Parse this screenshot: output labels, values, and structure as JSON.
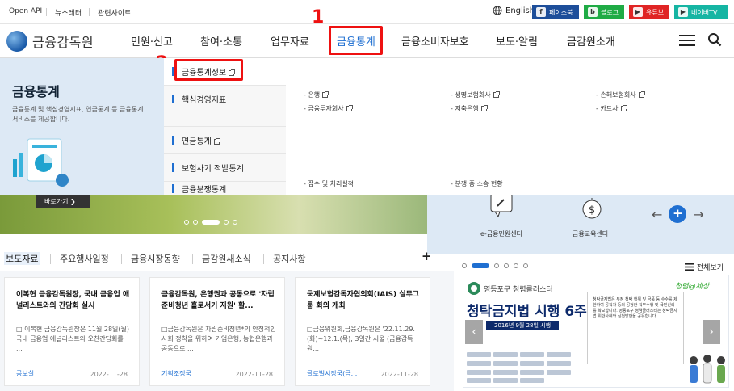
{
  "utility": {
    "links": [
      "Open API",
      "뉴스레터",
      "관련사이트"
    ],
    "language": "English",
    "sns": [
      {
        "label": "페이스북",
        "color": "#1d4e9a",
        "icon": "facebook-icon",
        "glyph": "f"
      },
      {
        "label": "블로그",
        "color": "#1fab45",
        "icon": "blog-icon",
        "glyph": "b"
      },
      {
        "label": "유튜브",
        "color": "#e02424",
        "icon": "youtube-icon",
        "glyph": "▶"
      },
      {
        "label": "네이버TV",
        "color": "#15b5a3",
        "icon": "navertv-icon",
        "glyph": "▶"
      }
    ]
  },
  "header": {
    "logo_text": "금융감독원",
    "menu": [
      "민원·신고",
      "참여·소통",
      "업무자료",
      "금융통계",
      "금융소비자보호",
      "보도·알림",
      "금감원소개"
    ],
    "active_menu": "금융통계"
  },
  "annotations": {
    "step1": "1",
    "step2": "2"
  },
  "mega": {
    "title": "금융통계",
    "description": "금융통계 및 핵심경영지표, 연금통계 등 금융통계 서비스를 제공합니다.",
    "categories": [
      "금융통계정보",
      "핵심경영지표",
      "연금통계",
      "보험사기 적발통계",
      "금융분쟁통계"
    ],
    "core_items": [
      "은행",
      "생명보험회사",
      "손해보험회사",
      "금융투자회사",
      "저축은행",
      "카드사"
    ],
    "dispute_items": [
      "접수 및 처리실적",
      "분쟁 중 소송 현황"
    ]
  },
  "hero": {
    "button": "바로가기 ❯"
  },
  "services": [
    {
      "label": "e-금융민원센터",
      "icon": "complaint-center-icon"
    },
    {
      "label": "금융교육센터",
      "icon": "education-center-icon"
    }
  ],
  "news": {
    "tabs": [
      "보도자료",
      "주요행사일정",
      "금융시장동향",
      "금감원새소식",
      "공지사항"
    ],
    "more": "+",
    "cards": [
      {
        "title": "이복현 금융감독원장, 국내 금융업 애널리스트와의 간담회 실시",
        "body": "□ 이복현 금융감독원장은 11월 28일(월) 국내 금융업 애널리스트와 오찬간담회를 ...",
        "dept": "공보실",
        "date": "2022-11-28"
      },
      {
        "title": "금융감독원, 은행권과 공동으로 '자립준비청년 홀로서기 지원' 활...",
        "body": "□금융감독원은 자립준비청년*의 안정적인 사회 정착을 위하여 기업은행, 농협은행과 공동으로 ...",
        "dept": "기획조정국",
        "date": "2022-11-28"
      },
      {
        "title": "국제보험감독자협의회(IAIS) 실무그룹 회의 개최",
        "body": "□금융위원회,금융감독원은 '22.11.29.(화)~12.1.(목), 3일간 서울 (금융감독원...",
        "dept": "글로벌시장국(금...",
        "date": "2022-11-28"
      }
    ]
  },
  "banner": {
    "all_view": "전체보기",
    "org": "영등포구 청렴클러스터",
    "headline": "청탁금지법 시행 6주년",
    "date": "2016년 9월 28일 시행",
    "signature": "청렴@세상",
    "note": "청탁금지법은 부정 청탁 행위 및 금품 등 수수를 제한하여 공직자 등의 공정한 직무수행 및 국민신뢰를 확보합니다. 영등포구 청렴클러스터는 청탁금지법 위반사례와 실천방안을 공유합니다."
  }
}
